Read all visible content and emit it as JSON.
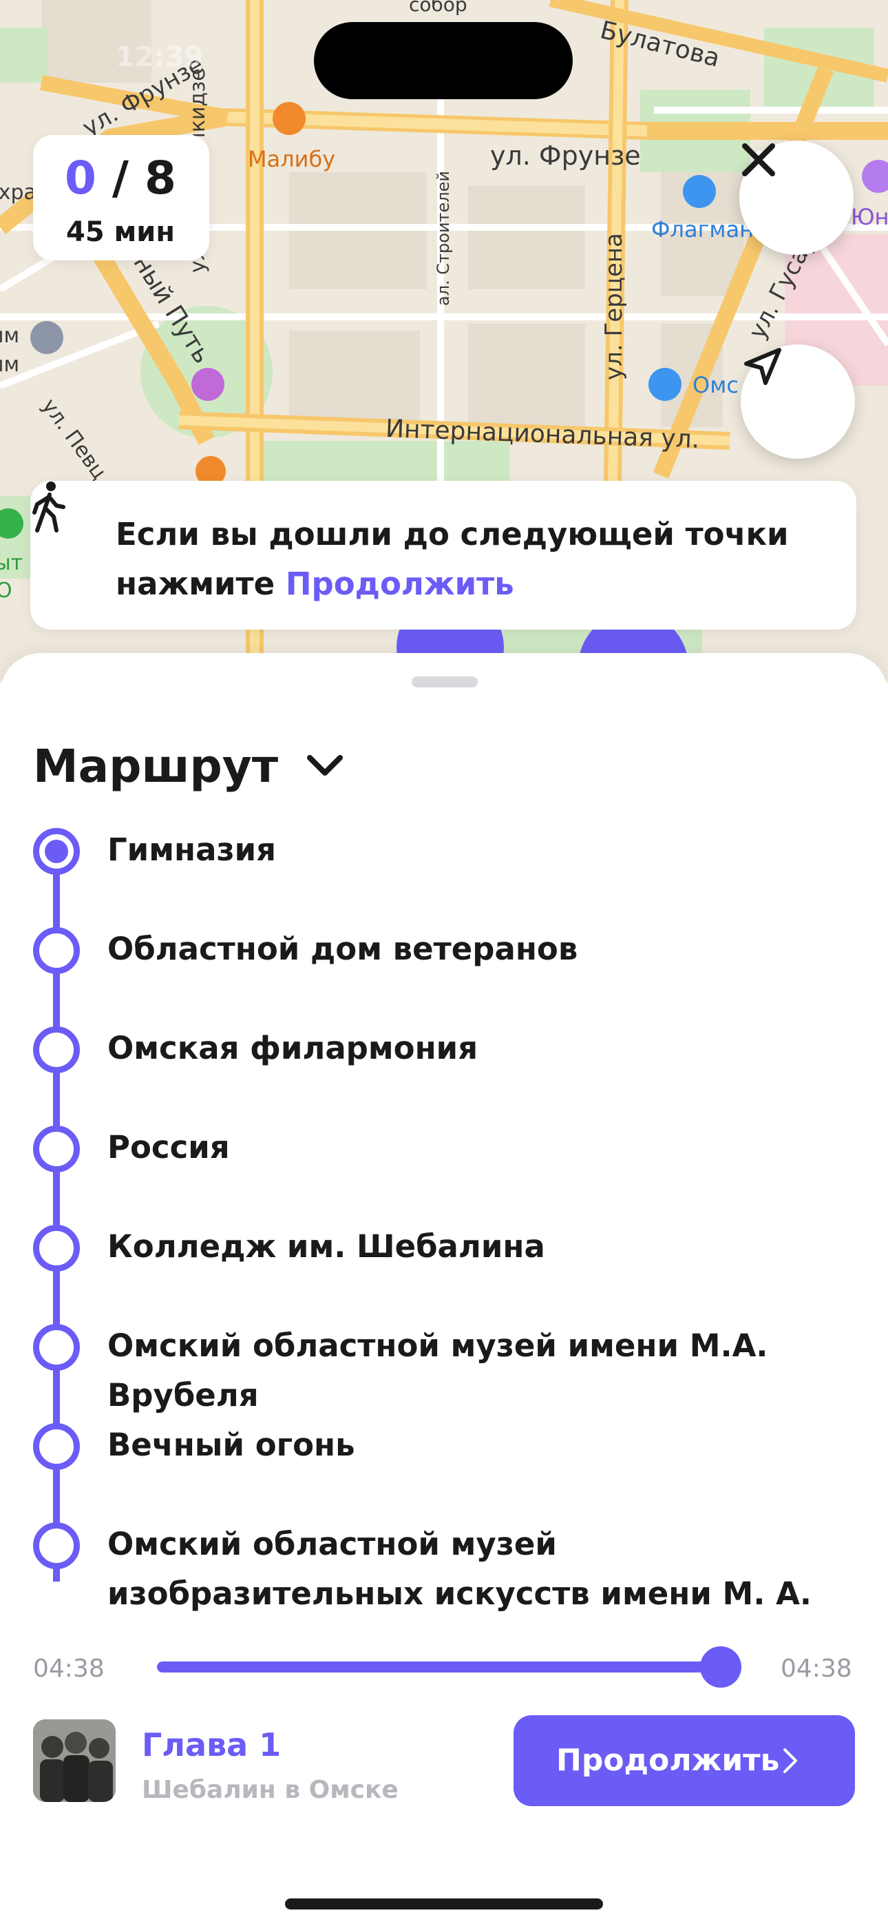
{
  "status_bar": {
    "time": "12:39"
  },
  "map": {
    "streets": [
      "ул. Фрунзе",
      "ул. Фрунзе",
      "Булатова",
      "ул. Орджоникидзе",
      "ал. Строителей",
      "ул. Герцена",
      "ул. Гусар",
      "Красный Путь",
      "Интернациональная ул.",
      "ул. Певц"
    ],
    "pois": [
      "Малибу",
      "Флагман",
      "Омс",
      "собор",
      "Юн"
    ],
    "edge_fragments": [
      "ухра",
      "им",
      "им",
      "ыт",
      "О"
    ]
  },
  "progress": {
    "done": "0",
    "separator": " / ",
    "total": "8",
    "duration": "45 мин"
  },
  "hint": {
    "text": "Если вы дошли до следующей точки нажмите ",
    "link": "Продолжить"
  },
  "route": {
    "title": "Маршрут",
    "stops": [
      {
        "name": "Гимназия",
        "active": true
      },
      {
        "name": "Областной дом ветеранов",
        "active": false
      },
      {
        "name": "Омская филармония",
        "active": false
      },
      {
        "name": "Россия",
        "active": false
      },
      {
        "name": "Колледж им. Шебалина",
        "active": false
      },
      {
        "name": "Омский областной музей имени М.А. Врубеля",
        "active": false
      },
      {
        "name": "Вечный огонь",
        "active": false
      },
      {
        "name": "Омский областной музей изобразительных искусств имени М. А.",
        "active": false
      }
    ]
  },
  "player": {
    "elapsed": "04:38",
    "total": "04:38",
    "progress_fraction": 0.98,
    "accent": "#6b5cf5"
  },
  "chapter": {
    "title": "Глава 1",
    "subtitle": "Шебалин в Омске"
  },
  "continue_button": {
    "label": "Продолжить"
  },
  "icons": [
    "close-icon",
    "navigation-arrow-icon",
    "walking-person-icon",
    "chevron-down-icon",
    "chevron-right-icon"
  ]
}
